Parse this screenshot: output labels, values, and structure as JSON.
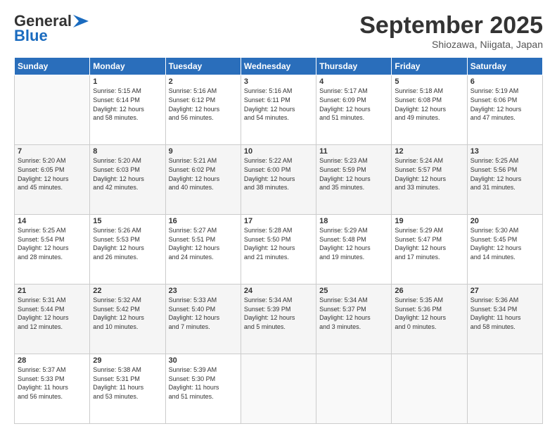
{
  "header": {
    "logo_general": "General",
    "logo_blue": "Blue",
    "month_title": "September 2025",
    "location": "Shiozawa, Niigata, Japan"
  },
  "days_of_week": [
    "Sunday",
    "Monday",
    "Tuesday",
    "Wednesday",
    "Thursday",
    "Friday",
    "Saturday"
  ],
  "weeks": [
    [
      {
        "day": "",
        "info": ""
      },
      {
        "day": "1",
        "info": "Sunrise: 5:15 AM\nSunset: 6:14 PM\nDaylight: 12 hours\nand 58 minutes."
      },
      {
        "day": "2",
        "info": "Sunrise: 5:16 AM\nSunset: 6:12 PM\nDaylight: 12 hours\nand 56 minutes."
      },
      {
        "day": "3",
        "info": "Sunrise: 5:16 AM\nSunset: 6:11 PM\nDaylight: 12 hours\nand 54 minutes."
      },
      {
        "day": "4",
        "info": "Sunrise: 5:17 AM\nSunset: 6:09 PM\nDaylight: 12 hours\nand 51 minutes."
      },
      {
        "day": "5",
        "info": "Sunrise: 5:18 AM\nSunset: 6:08 PM\nDaylight: 12 hours\nand 49 minutes."
      },
      {
        "day": "6",
        "info": "Sunrise: 5:19 AM\nSunset: 6:06 PM\nDaylight: 12 hours\nand 47 minutes."
      }
    ],
    [
      {
        "day": "7",
        "info": "Sunrise: 5:20 AM\nSunset: 6:05 PM\nDaylight: 12 hours\nand 45 minutes."
      },
      {
        "day": "8",
        "info": "Sunrise: 5:20 AM\nSunset: 6:03 PM\nDaylight: 12 hours\nand 42 minutes."
      },
      {
        "day": "9",
        "info": "Sunrise: 5:21 AM\nSunset: 6:02 PM\nDaylight: 12 hours\nand 40 minutes."
      },
      {
        "day": "10",
        "info": "Sunrise: 5:22 AM\nSunset: 6:00 PM\nDaylight: 12 hours\nand 38 minutes."
      },
      {
        "day": "11",
        "info": "Sunrise: 5:23 AM\nSunset: 5:59 PM\nDaylight: 12 hours\nand 35 minutes."
      },
      {
        "day": "12",
        "info": "Sunrise: 5:24 AM\nSunset: 5:57 PM\nDaylight: 12 hours\nand 33 minutes."
      },
      {
        "day": "13",
        "info": "Sunrise: 5:25 AM\nSunset: 5:56 PM\nDaylight: 12 hours\nand 31 minutes."
      }
    ],
    [
      {
        "day": "14",
        "info": "Sunrise: 5:25 AM\nSunset: 5:54 PM\nDaylight: 12 hours\nand 28 minutes."
      },
      {
        "day": "15",
        "info": "Sunrise: 5:26 AM\nSunset: 5:53 PM\nDaylight: 12 hours\nand 26 minutes."
      },
      {
        "day": "16",
        "info": "Sunrise: 5:27 AM\nSunset: 5:51 PM\nDaylight: 12 hours\nand 24 minutes."
      },
      {
        "day": "17",
        "info": "Sunrise: 5:28 AM\nSunset: 5:50 PM\nDaylight: 12 hours\nand 21 minutes."
      },
      {
        "day": "18",
        "info": "Sunrise: 5:29 AM\nSunset: 5:48 PM\nDaylight: 12 hours\nand 19 minutes."
      },
      {
        "day": "19",
        "info": "Sunrise: 5:29 AM\nSunset: 5:47 PM\nDaylight: 12 hours\nand 17 minutes."
      },
      {
        "day": "20",
        "info": "Sunrise: 5:30 AM\nSunset: 5:45 PM\nDaylight: 12 hours\nand 14 minutes."
      }
    ],
    [
      {
        "day": "21",
        "info": "Sunrise: 5:31 AM\nSunset: 5:44 PM\nDaylight: 12 hours\nand 12 minutes."
      },
      {
        "day": "22",
        "info": "Sunrise: 5:32 AM\nSunset: 5:42 PM\nDaylight: 12 hours\nand 10 minutes."
      },
      {
        "day": "23",
        "info": "Sunrise: 5:33 AM\nSunset: 5:40 PM\nDaylight: 12 hours\nand 7 minutes."
      },
      {
        "day": "24",
        "info": "Sunrise: 5:34 AM\nSunset: 5:39 PM\nDaylight: 12 hours\nand 5 minutes."
      },
      {
        "day": "25",
        "info": "Sunrise: 5:34 AM\nSunset: 5:37 PM\nDaylight: 12 hours\nand 3 minutes."
      },
      {
        "day": "26",
        "info": "Sunrise: 5:35 AM\nSunset: 5:36 PM\nDaylight: 12 hours\nand 0 minutes."
      },
      {
        "day": "27",
        "info": "Sunrise: 5:36 AM\nSunset: 5:34 PM\nDaylight: 11 hours\nand 58 minutes."
      }
    ],
    [
      {
        "day": "28",
        "info": "Sunrise: 5:37 AM\nSunset: 5:33 PM\nDaylight: 11 hours\nand 56 minutes."
      },
      {
        "day": "29",
        "info": "Sunrise: 5:38 AM\nSunset: 5:31 PM\nDaylight: 11 hours\nand 53 minutes."
      },
      {
        "day": "30",
        "info": "Sunrise: 5:39 AM\nSunset: 5:30 PM\nDaylight: 11 hours\nand 51 minutes."
      },
      {
        "day": "",
        "info": ""
      },
      {
        "day": "",
        "info": ""
      },
      {
        "day": "",
        "info": ""
      },
      {
        "day": "",
        "info": ""
      }
    ]
  ]
}
